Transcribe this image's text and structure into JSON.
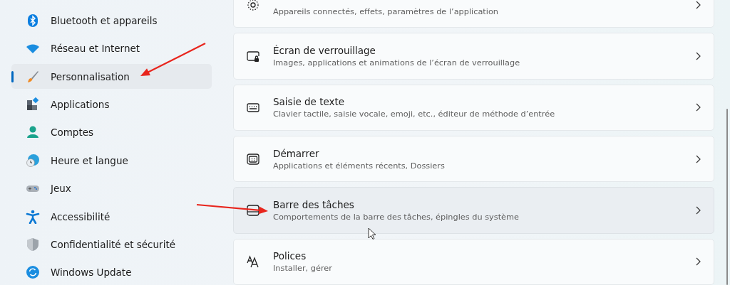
{
  "sidebar": {
    "items": [
      {
        "label": "Bluetooth et appareils",
        "selected": false
      },
      {
        "label": "Réseau et Internet",
        "selected": false
      },
      {
        "label": "Personnalisation",
        "selected": true
      },
      {
        "label": "Applications",
        "selected": false
      },
      {
        "label": "Comptes",
        "selected": false
      },
      {
        "label": "Heure et langue",
        "selected": false
      },
      {
        "label": "Jeux",
        "selected": false
      },
      {
        "label": "Accessibilité",
        "selected": false
      },
      {
        "label": "Confidentialité et sécurité",
        "selected": false
      },
      {
        "label": "Windows Update",
        "selected": false
      }
    ]
  },
  "settings": [
    {
      "description": "Appareils connectés, effets, paramètres de l’application",
      "hovered": false
    },
    {
      "title": "Écran de verrouillage",
      "description": "Images, applications et animations de l’écran de verrouillage",
      "hovered": false
    },
    {
      "title": "Saisie de texte",
      "description": "Clavier tactile, saisie vocale, emoji, etc., éditeur de méthode d’entrée",
      "hovered": false
    },
    {
      "title": "Démarrer",
      "description": "Applications et éléments récents, Dossiers",
      "hovered": false
    },
    {
      "title": "Barre des tâches",
      "description": "Comportements de la barre des tâches, épingles du système",
      "hovered": true
    },
    {
      "title": "Polices",
      "description": "Installer, gérer",
      "hovered": false
    }
  ],
  "annotations": [
    {
      "kind": "arrow"
    },
    {
      "kind": "arrow"
    },
    {
      "kind": "cursor"
    }
  ]
}
